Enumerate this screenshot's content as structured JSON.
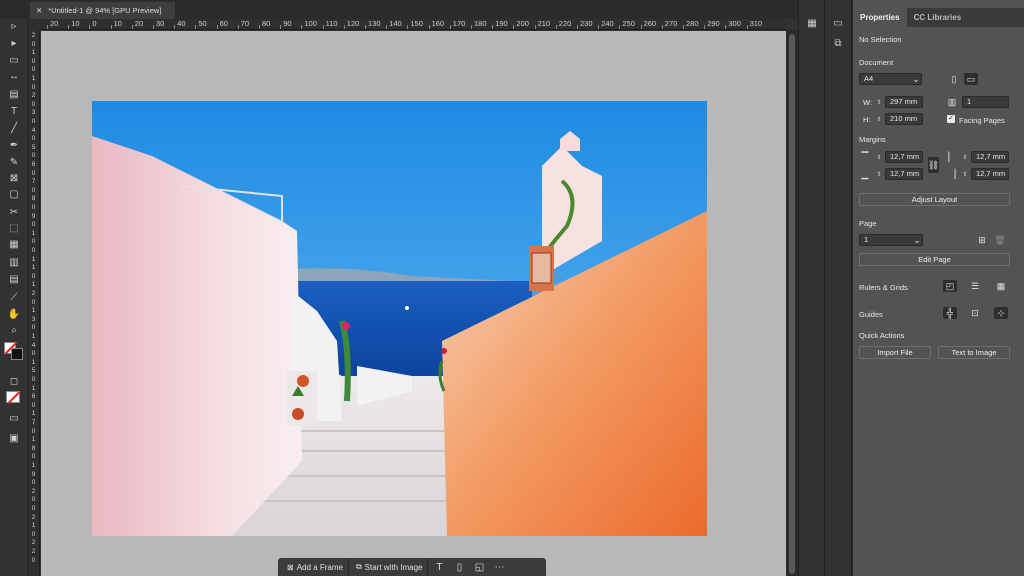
{
  "document_tab": {
    "title": "*Untitled-1 @ 94% [GPU Preview]",
    "close_glyph": "✕"
  },
  "ruler": {
    "h_ticks": [
      "20",
      "10",
      "0",
      "10",
      "20",
      "30",
      "40",
      "50",
      "60",
      "70",
      "80",
      "90",
      "100",
      "110",
      "120",
      "130",
      "140",
      "150",
      "160",
      "170",
      "180",
      "190",
      "200",
      "210",
      "220",
      "230",
      "240",
      "250",
      "260",
      "270",
      "280",
      "290",
      "300",
      "310"
    ],
    "v_ticks": [
      "2",
      "0",
      "1",
      "0",
      "0",
      "1",
      "0",
      "2",
      "0",
      "3",
      "0",
      "4",
      "0",
      "5",
      "0",
      "6",
      "0",
      "7",
      "0",
      "8",
      "0",
      "9",
      "0",
      "1",
      "0",
      "0",
      "1",
      "1",
      "0",
      "1",
      "2",
      "0",
      "1",
      "3",
      "0",
      "1",
      "4",
      "0",
      "1",
      "5",
      "0",
      "1",
      "6",
      "0",
      "1",
      "7",
      "0",
      "1",
      "8",
      "0",
      "1",
      "9",
      "0",
      "2",
      "0",
      "0",
      "2",
      "1",
      "0",
      "2",
      "2",
      "0"
    ]
  },
  "context_bar": {
    "add_frame": "Add a Frame",
    "start_with_image": "Start with Image",
    "icons": [
      "text-icon",
      "page-icon",
      "document-settings-icon",
      "more-icon"
    ]
  },
  "properties": {
    "tabs": [
      "Properties",
      "CC Libraries"
    ],
    "selection": "No Selection",
    "document": {
      "label": "Document",
      "preset": "A4",
      "w_label": "W:",
      "width": "297 mm",
      "h_label": "H:",
      "height": "210 mm",
      "pages": "1",
      "facing_pages": "Facing Pages",
      "facing_checked": true
    },
    "margins": {
      "label": "Margins",
      "top": "12,7 mm",
      "bottom": "12,7 mm",
      "left": "12,7 mm",
      "right": "12,7 mm",
      "adjust_layout": "Adjust Layout"
    },
    "page": {
      "label": "Page",
      "current": "1",
      "edit_page": "Edit Page"
    },
    "rulers_grids": "Rulers & Grids",
    "guides": "Guides",
    "quick_actions": {
      "label": "Quick Actions",
      "import_file": "Import File",
      "text_to_image": "Text to Image"
    }
  },
  "colors": {
    "accent_sky": "#1f8de6",
    "sea": "#0e54b5",
    "wall_orange": "#f08d55",
    "wall_pink": "#f0c8cf"
  }
}
